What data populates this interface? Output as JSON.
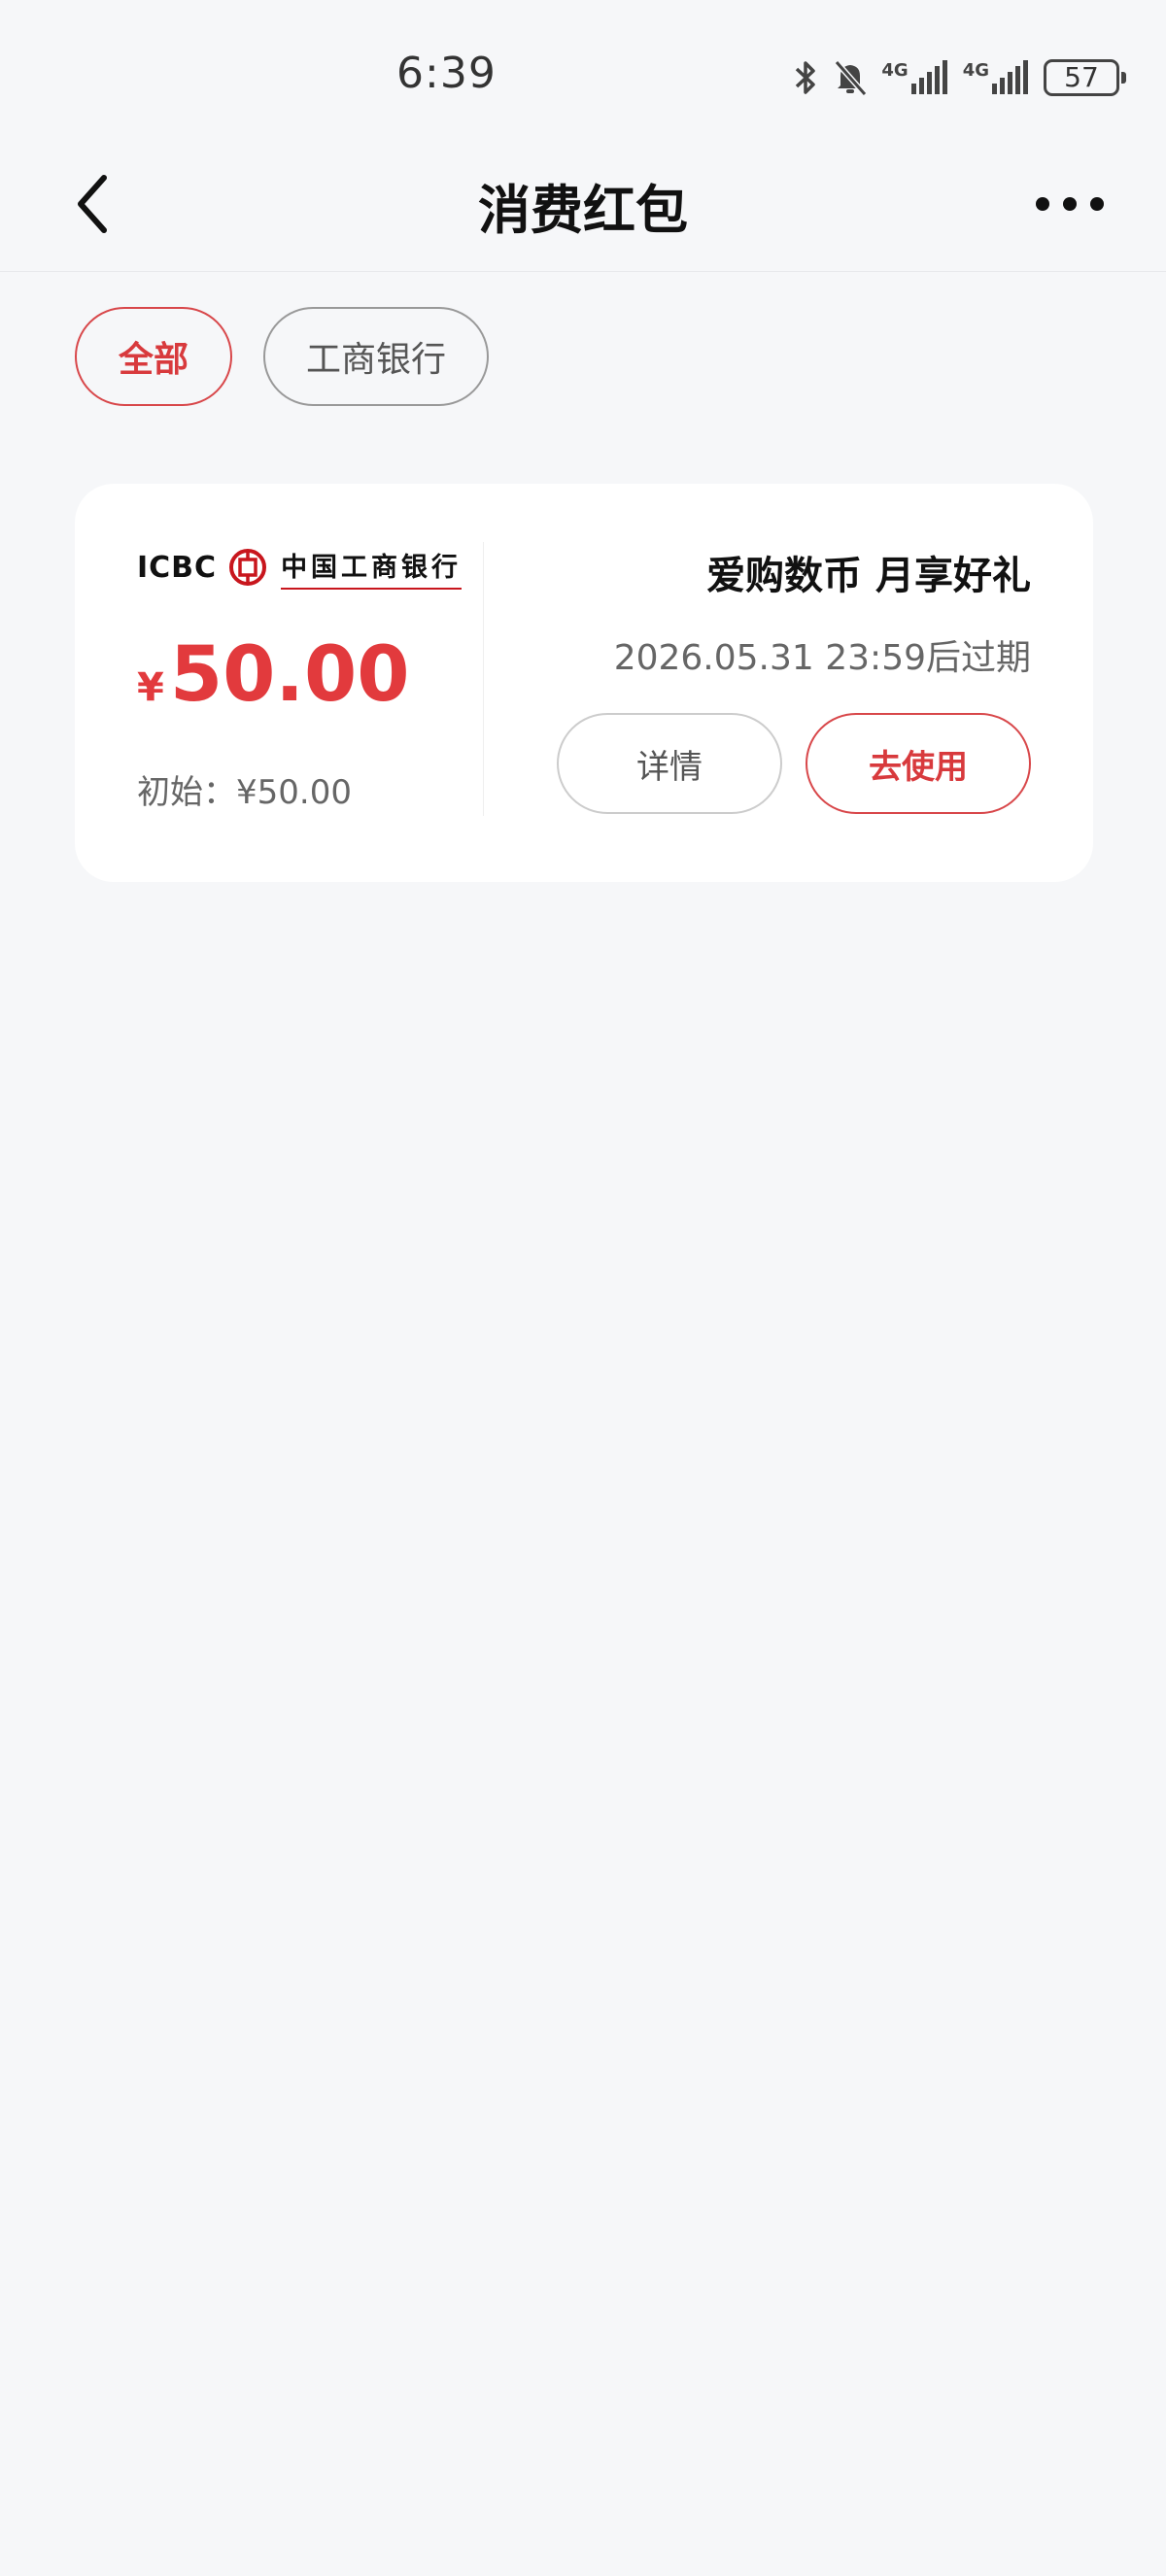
{
  "status_bar": {
    "time": "6:39",
    "battery": "57",
    "network_1": "4G",
    "network_2": "4G",
    "icons": [
      "bluetooth-icon",
      "mute-bell-icon",
      "signal-icon",
      "signal-icon",
      "battery-icon"
    ]
  },
  "nav": {
    "title": "消费红包",
    "back_icon": "chevron-left-icon",
    "more_icon": "more-dots-icon"
  },
  "filters": [
    {
      "label": "全部",
      "active": true
    },
    {
      "label": "工商银行",
      "active": false
    }
  ],
  "card": {
    "logo_en": "ICBC",
    "logo_cn": "中国工商银行",
    "amount_symbol": "¥",
    "amount": "50.00",
    "initial": "初始：¥50.00",
    "title": "爱购数币 月享好礼",
    "expiry": "2026.05.31 23:59后过期",
    "detail_label": "详情",
    "use_label": "去使用"
  },
  "colors": {
    "accent": "#e23a3d",
    "brand_red": "#c8161d",
    "background": "#f6f7f9"
  }
}
